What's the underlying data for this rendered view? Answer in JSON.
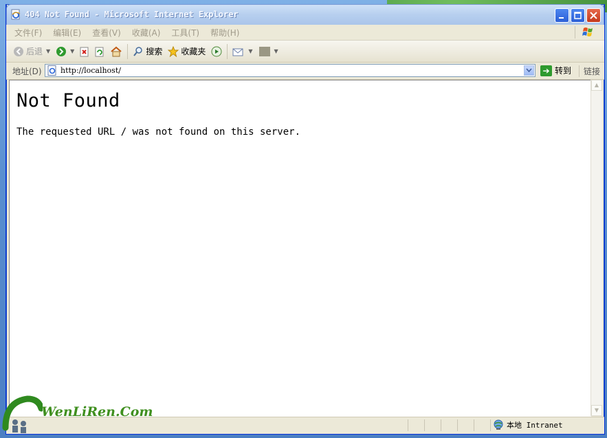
{
  "window": {
    "title": "404 Not Found - Microsoft Internet Explorer"
  },
  "menu": [
    "文件(F)",
    "编辑(E)",
    "查看(V)",
    "收藏(A)",
    "工具(T)",
    "帮助(H)"
  ],
  "toolbar": {
    "back": "后退",
    "search": "搜索",
    "favorites": "收藏夹"
  },
  "address": {
    "label": "地址(D)",
    "url": "http://localhost/",
    "go": "转到",
    "links": "链接"
  },
  "page": {
    "heading": "Not Found",
    "message": "The requested URL / was not found on this server."
  },
  "status": {
    "zone": "本地 Intranet"
  },
  "watermark": {
    "text": "WenLiRen.Com"
  }
}
